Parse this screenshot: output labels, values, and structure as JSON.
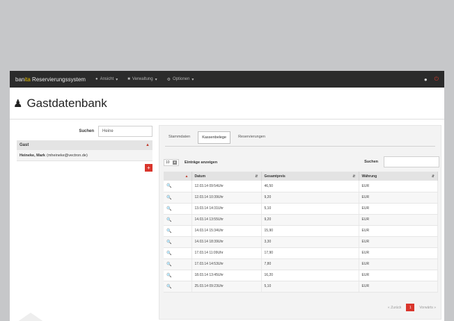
{
  "navbar": {
    "brand_pre": "ban",
    "brand_hl": "ita",
    "brand_post": " Reservierungssystem",
    "menus": [
      {
        "icon": "user-icon",
        "label": "Ansicht"
      },
      {
        "icon": "folder-icon",
        "label": "Verwaltung"
      },
      {
        "icon": "gear-icon",
        "label": "Optionen"
      }
    ]
  },
  "header": {
    "title": "Gastdatenbank"
  },
  "guest_search": {
    "label": "Suchen",
    "value": "Heine"
  },
  "guest_list": {
    "column": "Gast",
    "rows": [
      {
        "name": "Heineke, Mark",
        "email": "(mheineke@vectron.de)"
      }
    ],
    "add_label": "+"
  },
  "tabs": [
    {
      "label": "Stammdaten",
      "active": false
    },
    {
      "label": "Kassenbelege",
      "active": true
    },
    {
      "label": "Reservierungen",
      "active": false
    }
  ],
  "table": {
    "length_value": "10",
    "length_label": "Einträge anzeigen",
    "search_label": "Suchen",
    "columns": [
      "",
      "Datum",
      "Gesamtpreis",
      "Währung"
    ],
    "rows": [
      {
        "date": "12.03.14 09:54Uhr",
        "price": "46,50",
        "currency": "EUR"
      },
      {
        "date": "12.03.14 10:39Uhr",
        "price": "9,20",
        "currency": "EUR"
      },
      {
        "date": "13.03.14 14:31Uhr",
        "price": "5,10",
        "currency": "EUR"
      },
      {
        "date": "14.03.14 13:55Uhr",
        "price": "9,20",
        "currency": "EUR"
      },
      {
        "date": "14.03.14 15:34Uhr",
        "price": "15,90",
        "currency": "EUR"
      },
      {
        "date": "14.03.14 18:39Uhr",
        "price": "3,30",
        "currency": "EUR"
      },
      {
        "date": "17.03.14 11:09Uhr",
        "price": "17,90",
        "currency": "EUR"
      },
      {
        "date": "17.03.14 14:53Uhr",
        "price": "7,80",
        "currency": "EUR"
      },
      {
        "date": "18.03.14 13:45Uhr",
        "price": "16,20",
        "currency": "EUR"
      },
      {
        "date": "25.03.14 09:23Uhr",
        "price": "5,10",
        "currency": "EUR"
      }
    ]
  },
  "pager": {
    "prev": "« Zurück",
    "current": "1",
    "next": "Vorwärts »"
  }
}
